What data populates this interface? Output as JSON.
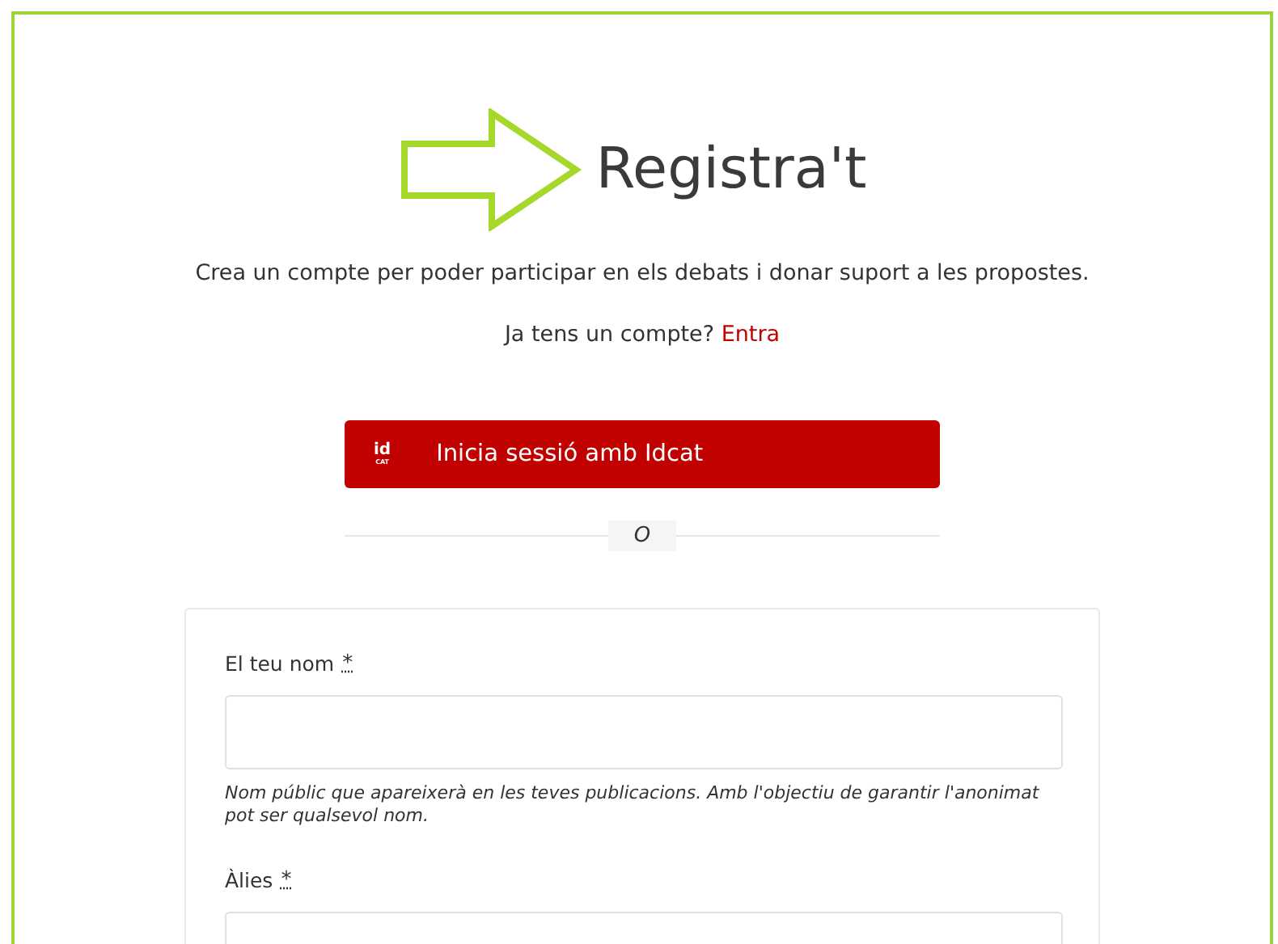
{
  "title": "Registra't",
  "subtitle": "Crea un compte per poder participar en els debats i donar suport a les propostes.",
  "login_prompt": {
    "text": "Ja tens un compte?",
    "link": "Entra"
  },
  "idcat_button": {
    "logo_top": "id",
    "logo_bottom": "CAT",
    "label": "Inicia sessió amb Idcat"
  },
  "separator": "O",
  "fields": [
    {
      "label": "El teu nom",
      "required_mark": "*",
      "help": "Nom públic que apareixerà en les teves publicacions. Amb l'objectiu de garantir l'anonimat pot ser qualsevol nom."
    },
    {
      "label": "Àlies",
      "required_mark": "*"
    }
  ]
}
